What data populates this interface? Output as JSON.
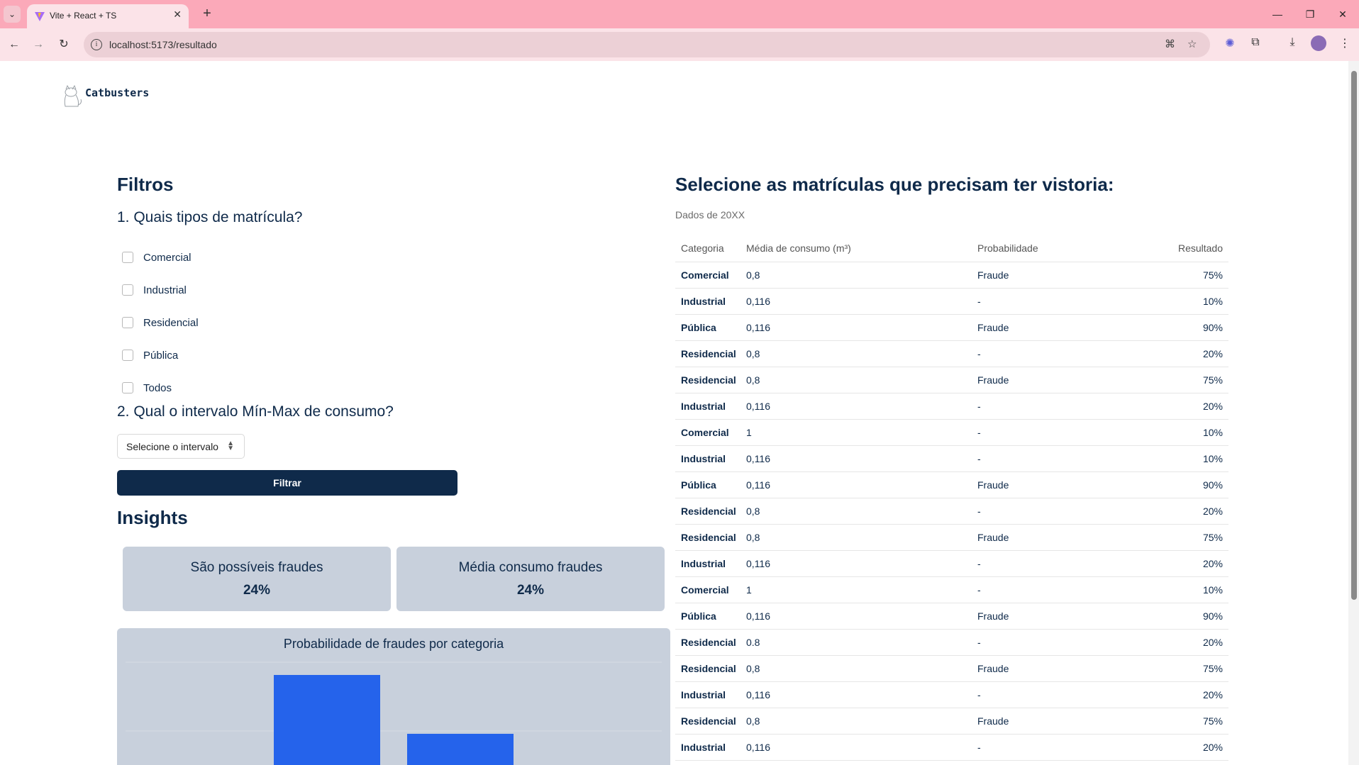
{
  "browser": {
    "tab_title": "Vite + React + TS",
    "url": "localhost:5173/resultado"
  },
  "brand": {
    "name": "Catbusters"
  },
  "filters": {
    "title": "Filtros",
    "question1": "1. Quais tipos de matrícula?",
    "options": [
      "Comercial",
      "Industrial",
      "Residencial",
      "Pública",
      "Todos"
    ],
    "question2": "2. Qual o intervalo Mín-Max de consumo?",
    "interval_select": "Selecione o intervalo",
    "filter_button": "Filtrar"
  },
  "insights": {
    "title": "Insights",
    "cards": [
      {
        "label": "São possíveis fraudes",
        "value": "24%"
      },
      {
        "label": "Média consumo fraudes",
        "value": "24%"
      }
    ]
  },
  "chart_data": {
    "type": "bar",
    "title": "Probabilidade de fraudes por categoria",
    "bar_color": "#2563eb"
  },
  "table_section": {
    "title": "Selecione as matrículas que precisam ter vistoria:",
    "subtitle": "Dados de 20XX",
    "headers": [
      "Categoria",
      "Média de consumo (m³)",
      "Probabilidade",
      "Resultado"
    ],
    "rows": [
      [
        "Comercial",
        "0,8",
        "Fraude",
        "75%"
      ],
      [
        "Industrial",
        "0,116",
        "-",
        "10%"
      ],
      [
        "Pública",
        "0,116",
        "Fraude",
        "90%"
      ],
      [
        "Residencial",
        "0,8",
        "-",
        "20%"
      ],
      [
        "Residencial",
        "0,8",
        "Fraude",
        "75%"
      ],
      [
        "Industrial",
        "0,116",
        "-",
        "20%"
      ],
      [
        "Comercial",
        "1",
        "-",
        "10%"
      ],
      [
        "Industrial",
        "0,116",
        "-",
        "10%"
      ],
      [
        "Pública",
        "0,116",
        "Fraude",
        "90%"
      ],
      [
        "Residencial",
        "0,8",
        "-",
        "20%"
      ],
      [
        "Residencial",
        "0,8",
        "Fraude",
        "75%"
      ],
      [
        "Industrial",
        "0,116",
        "-",
        "20%"
      ],
      [
        "Comercial",
        "1",
        "-",
        "10%"
      ],
      [
        "Pública",
        "0,116",
        "Fraude",
        "90%"
      ],
      [
        "Residencial",
        "0.8",
        "-",
        "20%"
      ],
      [
        "Residencial",
        "0,8",
        "Fraude",
        "75%"
      ],
      [
        "Industrial",
        "0,116",
        "-",
        "20%"
      ],
      [
        "Residencial",
        "0,8",
        "Fraude",
        "75%"
      ],
      [
        "Industrial",
        "0,116",
        "-",
        "20%"
      ]
    ]
  },
  "colors": {
    "chrome": "#fba9b9",
    "navy": "#0f2a4a",
    "card_bg": "#c8d0dc"
  }
}
